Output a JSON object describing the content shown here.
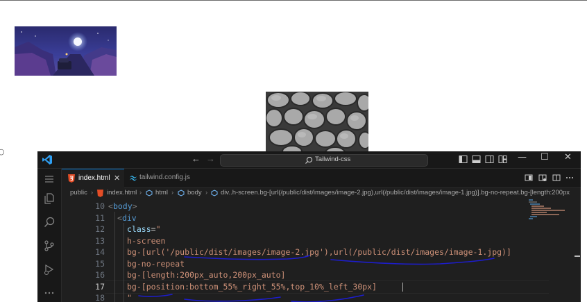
{
  "window": {
    "search_label": "Tailwind-css"
  },
  "tabs": [
    {
      "label": "index.html",
      "active": true
    },
    {
      "label": "tailwind.config.js",
      "active": false
    }
  ],
  "breadcrumb": [
    "public",
    "index.html",
    "html",
    "body",
    "div..h-screen.bg-[url(/public/dist/images/image-2.jpg),url(/public/dist/images/image-1.jpg)].bg-no-repeat.bg-[length:200px"
  ],
  "editor": {
    "current_line": "17",
    "line_numbers": [
      "10",
      "11",
      "12",
      "13",
      "14",
      "15",
      "16",
      "17",
      "18"
    ],
    "lines": {
      "l10": {
        "ang1": "<",
        "tag": "body",
        "ang2": ">"
      },
      "l11": {
        "ang1": "<",
        "tag": "div"
      },
      "l12": {
        "attr": "class",
        "eq": "=",
        "quote": "\""
      },
      "l13": "h-screen",
      "l14": "bg-[url('/public/dist/images/image-2.jpg'),url(/public/dist/images/image-1.jpg)]",
      "l15": "bg-no-repeat",
      "l16": "bg-[length:200px_auto,200px_auto]",
      "l17": "bg-[position:bottom_55%_right_55%,top_10%_left_30px]",
      "l18": "\""
    }
  },
  "colors": {
    "editor_bg": "#1f1f1f",
    "titlebar_bg": "#181818",
    "accent": "#0078d4",
    "annotation": "#1d1dcc",
    "html_icon": "#e44d26"
  },
  "icons": {
    "titlebar": [
      "vscode-logo-icon",
      "back-arrow-icon",
      "forward-arrow-icon",
      "search-icon",
      "toggle-primary-sidebar-icon",
      "toggle-panel-icon",
      "toggle-secondary-sidebar-icon",
      "customize-layout-icon",
      "minimize-icon",
      "maximize-icon",
      "close-icon"
    ],
    "activity": [
      "menu-icon",
      "explorer-icon",
      "search-icon",
      "source-control-icon",
      "run-debug-icon",
      "more-icon"
    ]
  }
}
